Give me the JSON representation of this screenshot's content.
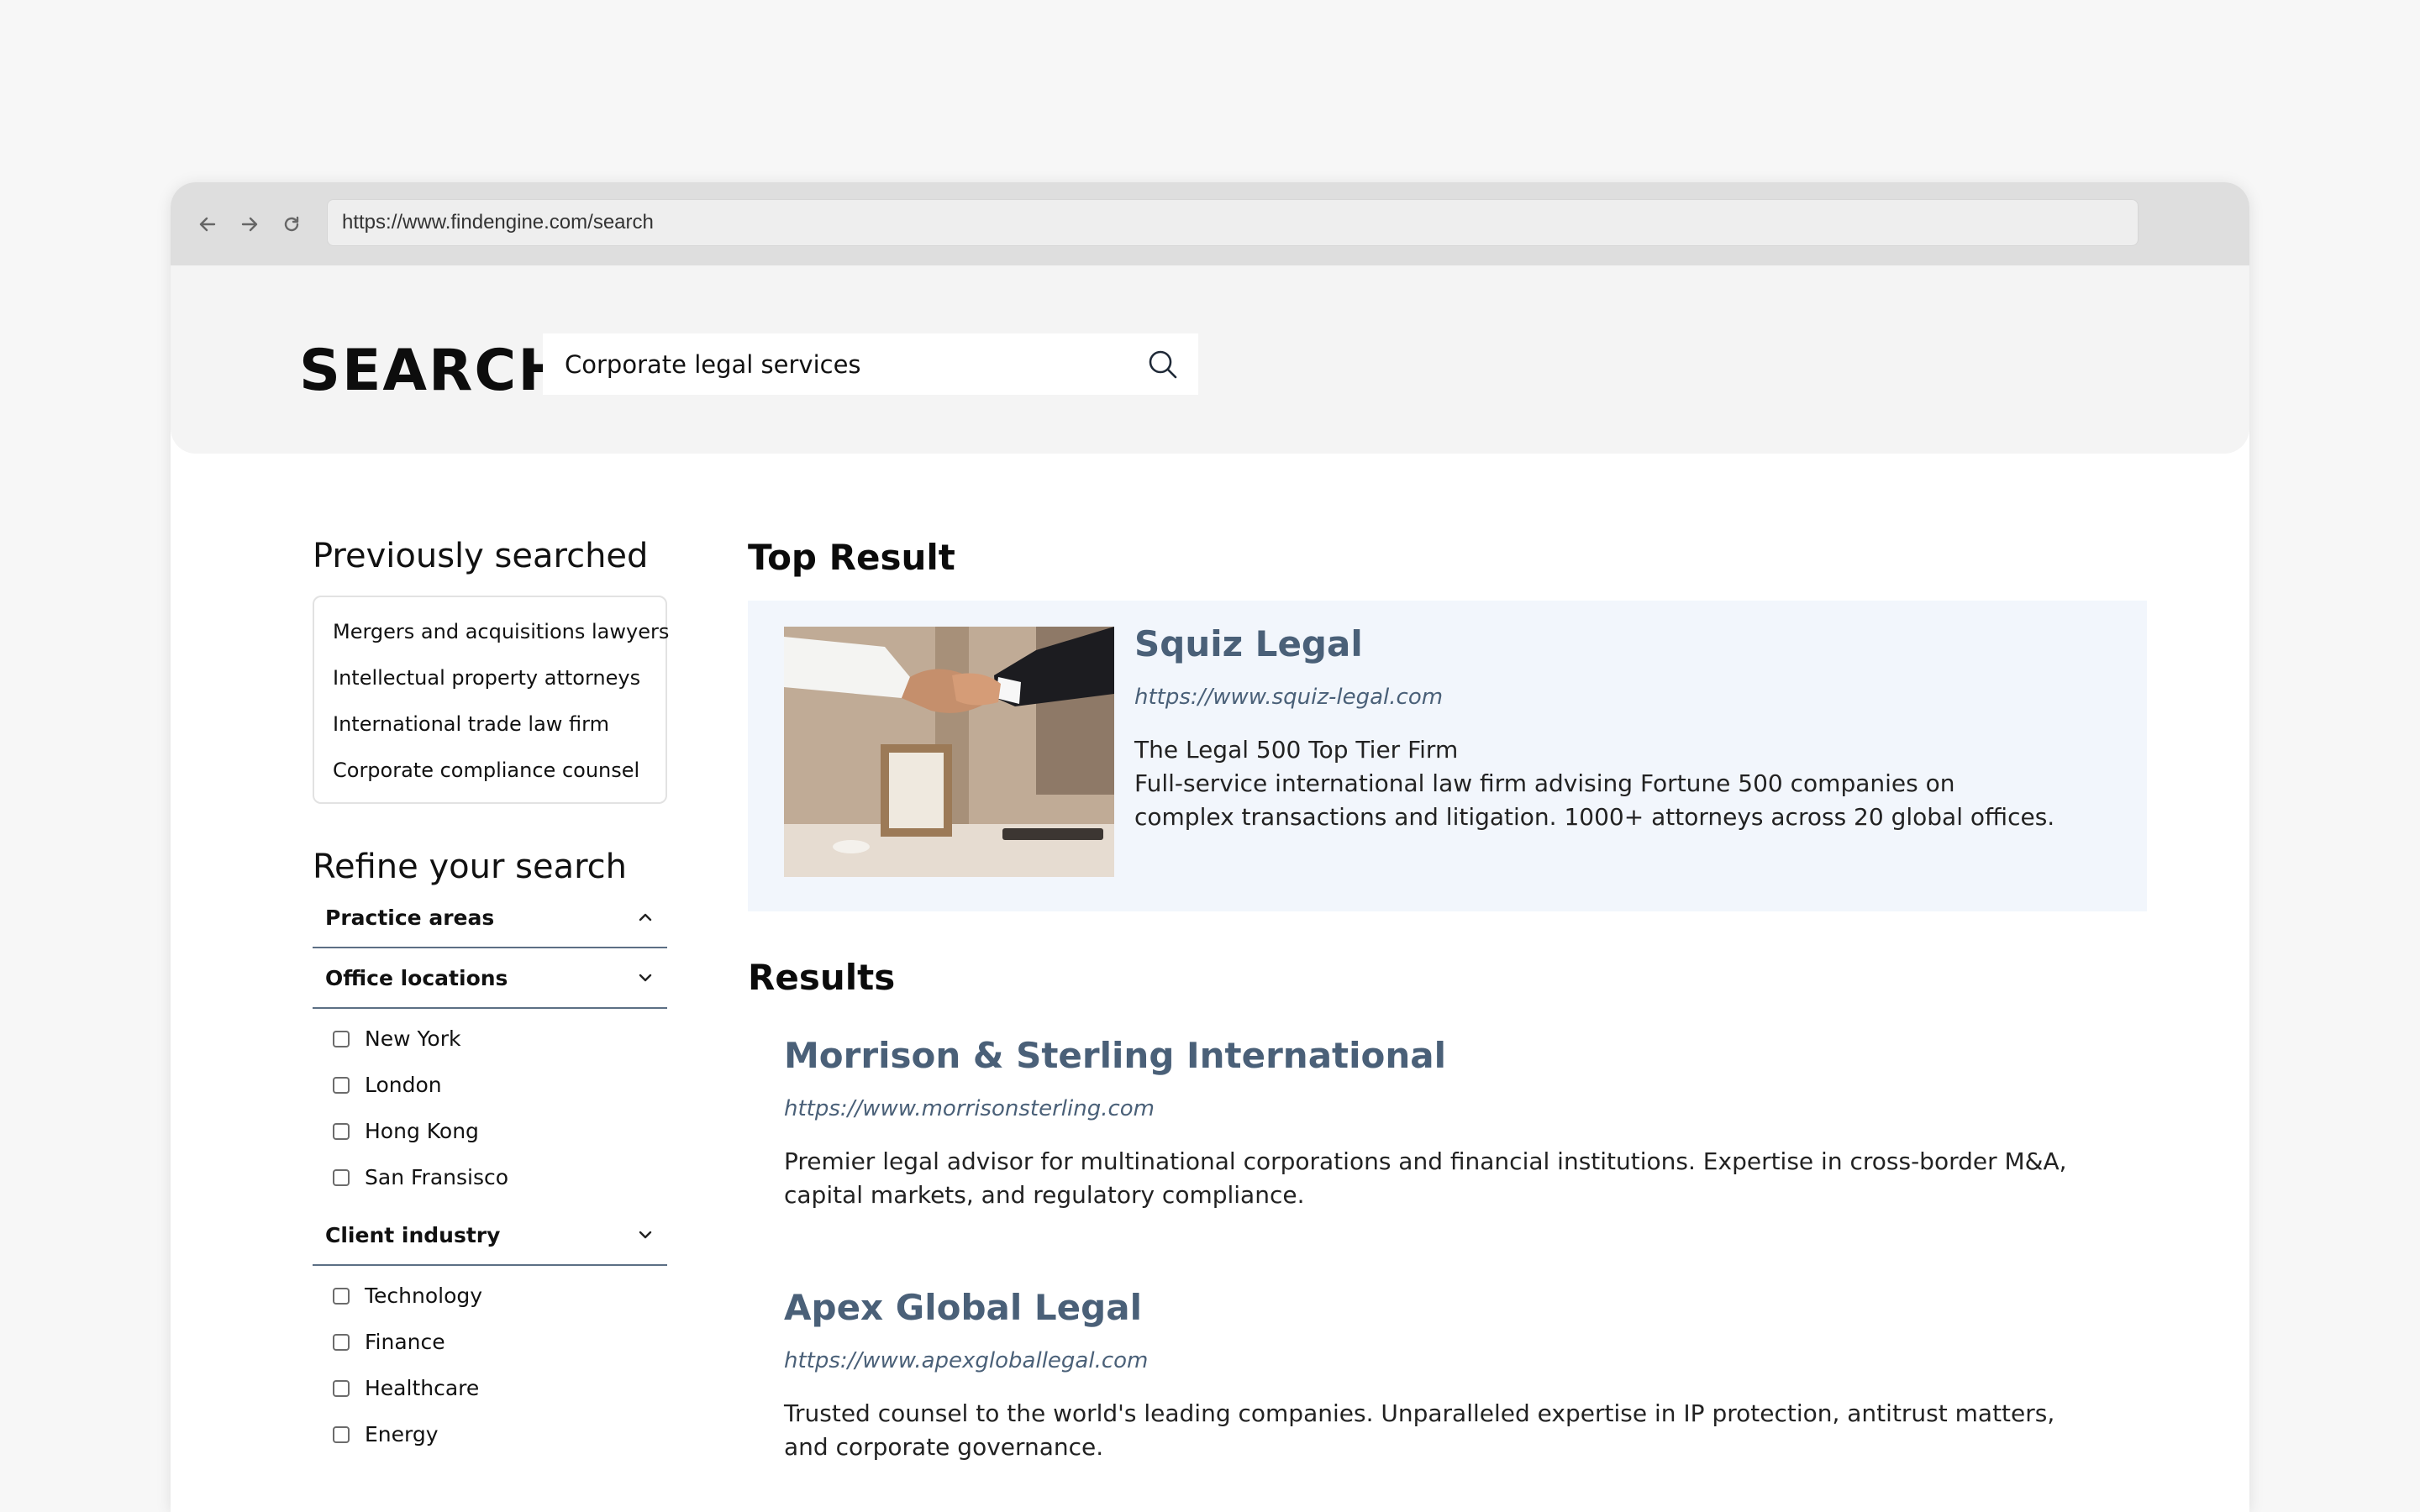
{
  "browser": {
    "url": "https://www.findengine.com/search"
  },
  "header": {
    "logo": "SEARCH",
    "search_value": "Corporate legal services"
  },
  "sidebar": {
    "previous_heading": "Previously searched",
    "previous": [
      "Mergers and acquisitions lawyers",
      "Intellectual property attorneys",
      "International trade law firm",
      "Corporate compliance counsel"
    ],
    "refine_heading": "Refine your search",
    "filters": [
      {
        "title": "Practice areas",
        "expanded": false,
        "options": []
      },
      {
        "title": "Office locations",
        "expanded": true,
        "options": [
          "New York",
          "London",
          "Hong Kong",
          "San Fransisco"
        ]
      },
      {
        "title": "Client industry",
        "expanded": true,
        "options": [
          "Technology",
          "Finance",
          "Healthcare",
          "Energy"
        ]
      }
    ]
  },
  "main": {
    "top_heading": "Top Result",
    "top_result": {
      "title": "Squiz Legal",
      "url": "https://www.squiz-legal.com",
      "tagline": "The Legal 500 Top Tier Firm",
      "description": "Full-service international law firm advising Fortune 500 companies on complex transactions and litigation. 1000+ attorneys across 20 global offices."
    },
    "results_heading": "Results",
    "results": [
      {
        "title": "Morrison & Sterling International",
        "url": "https://www.morrisonsterling.com",
        "description": "Premier legal advisor for multinational corporations and financial institutions. Expertise in cross-border M&A, capital markets, and regulatory compliance."
      },
      {
        "title": "Apex Global Legal",
        "url": "https://www.apexgloballegal.com",
        "description": "Trusted counsel to the world's leading companies. Unparalleled expertise in IP protection, antitrust matters, and corporate governance."
      }
    ]
  }
}
